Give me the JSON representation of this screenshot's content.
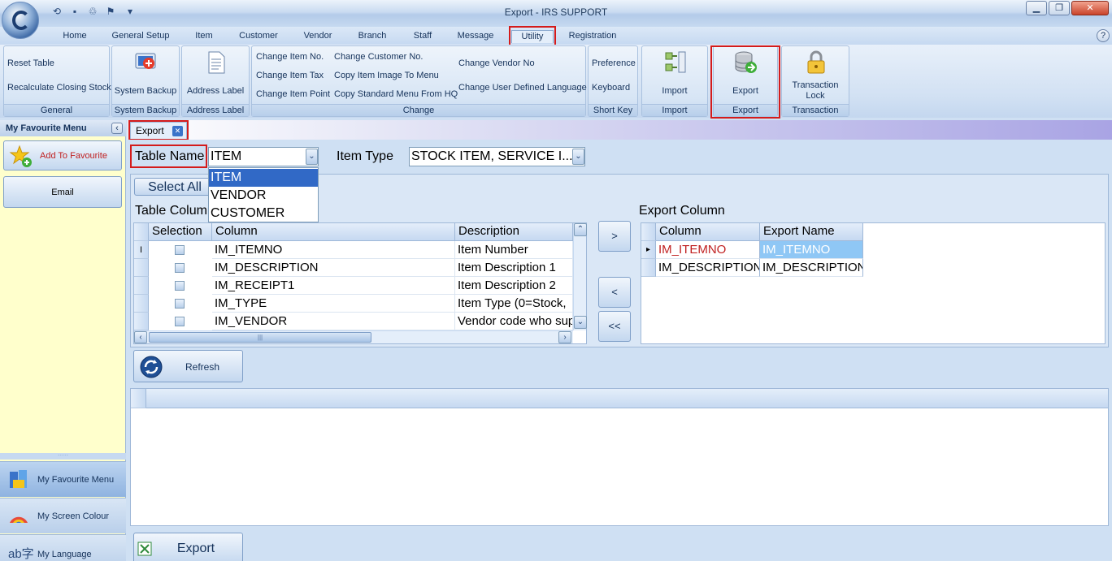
{
  "window": {
    "title": "Export - IRS SUPPORT",
    "min": "▁",
    "restore": "❐",
    "close": "✕"
  },
  "quick_access": {
    "icons": [
      "history-icon",
      "save-icon",
      "clean-icon",
      "tools-icon",
      "dropdown-icon"
    ],
    "glyphs": [
      "⟲",
      "▪",
      "♲",
      "⚑",
      "▾"
    ]
  },
  "menu_tabs": [
    "Home",
    "General Setup",
    "Item",
    "Customer",
    "Vendor",
    "Branch",
    "Staff",
    "Message",
    "Utility",
    "Registration"
  ],
  "active_tab": "Utility",
  "help_glyph": "?",
  "ribbon": {
    "general": {
      "items": [
        "Reset Table",
        "Recalculate Closing Stock"
      ],
      "label": "General"
    },
    "system_backup": {
      "item": "System Backup",
      "label": "System Backup"
    },
    "address_label": {
      "item": "Address Label",
      "label": "Address Label"
    },
    "change": {
      "col1": [
        "Change Item No.",
        "Change Item Tax",
        "Change Item Point"
      ],
      "col2": [
        "Change Customer No.",
        "Copy Item Image To Menu",
        "Copy Standard Menu From HQ"
      ],
      "col3": [
        "Change Vendor No",
        "Change User Defined Language"
      ],
      "label": "Change"
    },
    "short_key": {
      "items": [
        "Preference",
        "Keyboard"
      ],
      "label": "Short Key"
    },
    "import": {
      "item": "Import",
      "label": "Import"
    },
    "export": {
      "item": "Export",
      "label": "Export"
    },
    "transaction": {
      "item": "Transaction Lock",
      "label": "Transaction"
    }
  },
  "sidebar": {
    "title": "My Favourite Menu",
    "collapse_glyph": "‹",
    "add_favourite": "Add To Favourite",
    "email": "Email",
    "grip": "·····",
    "bottom": [
      "My Favourite Menu",
      "My Screen Colour",
      "My Language"
    ]
  },
  "doc_tab": {
    "label": "Export",
    "close_glyph": "✕"
  },
  "form": {
    "table_name_label": "Table Name",
    "table_name_value": "ITEM",
    "dropdown_glyph": "⌄",
    "item_type_label": "Item Type",
    "item_type_value": "STOCK ITEM, SERVICE I...",
    "table_options": [
      "ITEM",
      "VENDOR",
      "CUSTOMER"
    ],
    "select_all": "Select All",
    "table_column_label": "Table Column",
    "export_column_label": "Export Column",
    "move_right": ">",
    "move_left": "<",
    "move_all_left": "<<",
    "refresh": "Refresh",
    "export_button": "Export"
  },
  "table_columns": {
    "headers": [
      "Selection",
      "Column",
      "Description"
    ],
    "row_indicator": "I",
    "rows": [
      {
        "column": "IM_ITEMNO",
        "description": "Item Number"
      },
      {
        "column": "IM_DESCRIPTION",
        "description": "Item Description 1"
      },
      {
        "column": "IM_RECEIPT1",
        "description": "Item Description 2"
      },
      {
        "column": "IM_TYPE",
        "description": "Item Type (0=Stock,"
      },
      {
        "column": "IM_VENDOR",
        "description": "Vendor code who sup"
      }
    ],
    "scroll_glyphs": {
      "up": "⌃",
      "down": "⌄",
      "left": "‹",
      "right": "›",
      "grip": "|||"
    }
  },
  "export_columns": {
    "headers": [
      "Column",
      "Export Name"
    ],
    "row_indicator": "▸",
    "rows": [
      {
        "column": "IM_ITEMNO",
        "export_name": "IM_ITEMNO"
      },
      {
        "column": "IM_DESCRIPTION",
        "export_name": "IM_DESCRIPTION"
      }
    ]
  },
  "colors": {
    "highlight_red": "#d41b1b",
    "selection_blue": "#3169c6",
    "export_name_selected": "#8fc7f5",
    "sidebar_bg": "#ffffcc"
  }
}
